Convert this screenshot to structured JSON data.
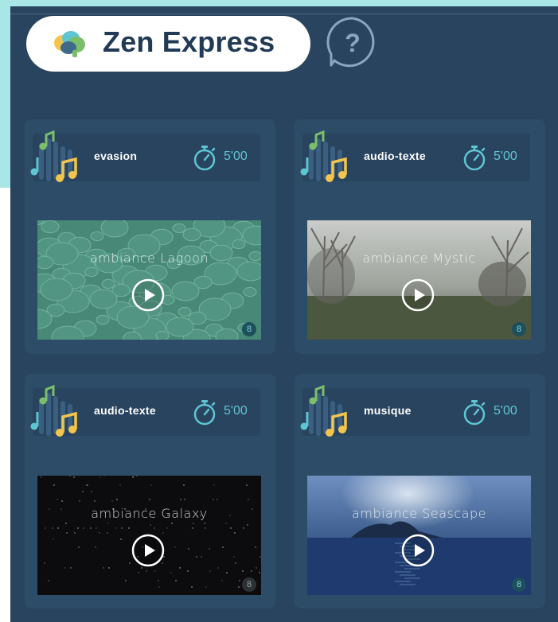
{
  "app": {
    "title": "Zen Express"
  },
  "help": {
    "label": "?"
  },
  "cards": [
    {
      "type": "evasion",
      "duration": "5'00",
      "ambiance": "ambiance Lagoon",
      "badge": "8"
    },
    {
      "type": "audio-texte",
      "duration": "5'00",
      "ambiance": "ambiance Mystic",
      "badge": "8"
    },
    {
      "type": "audio-texte",
      "duration": "5'00",
      "ambiance": "ambiance Galaxy",
      "badge": "8"
    },
    {
      "type": "musique",
      "duration": "5'00",
      "ambiance": "ambiance Seascape",
      "badge": "8"
    }
  ],
  "icons": {
    "brand": "brain-icon",
    "help": "help-bubble-icon",
    "category": "music-notes-icon",
    "timer": "stopwatch-icon",
    "play": "play-icon"
  },
  "colors": {
    "background": "#29445e",
    "card": "#2d4c67",
    "accent": "#5ec6d3",
    "note_yellow": "#f3c54c",
    "note_green": "#7cbf6a",
    "title": "#213a55"
  }
}
